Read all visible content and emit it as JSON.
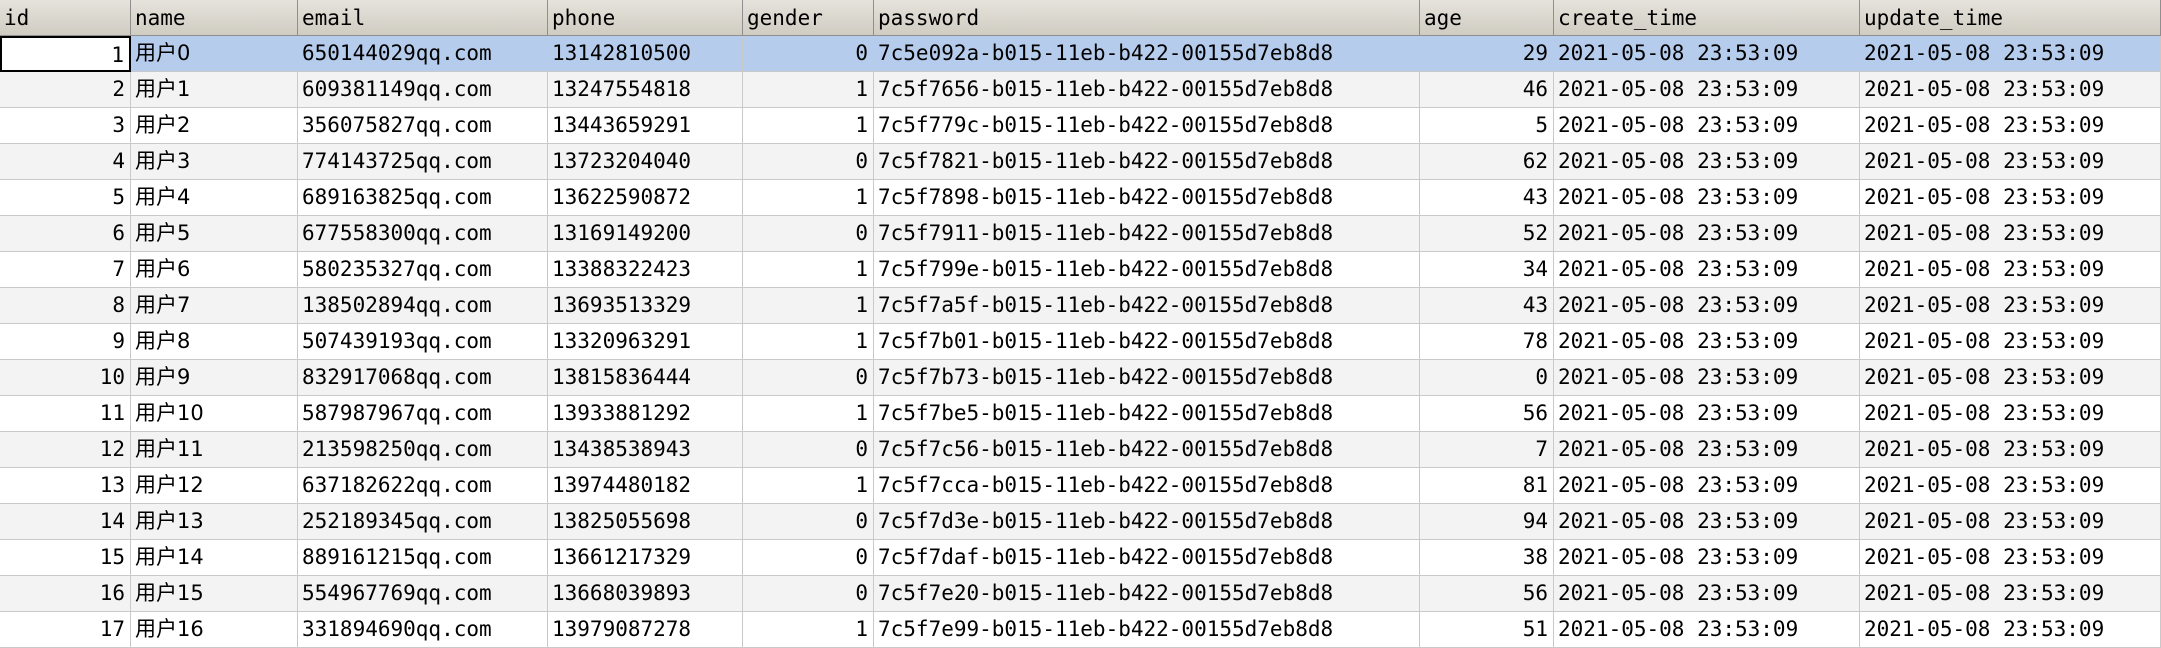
{
  "columns": {
    "id": "id",
    "name": "name",
    "email": "email",
    "phone": "phone",
    "gender": "gender",
    "password": "password",
    "age": "age",
    "create_time": "create_time",
    "update_time": "update_time"
  },
  "selected_row": 1,
  "rows": [
    {
      "id": "1",
      "name": "用户0",
      "email": "650144029qq.com",
      "phone": "13142810500",
      "gender": "0",
      "password": "7c5e092a-b015-11eb-b422-00155d7eb8d8",
      "age": "29",
      "create_time": "2021-05-08 23:53:09",
      "update_time": "2021-05-08 23:53:09"
    },
    {
      "id": "2",
      "name": "用户1",
      "email": "609381149qq.com",
      "phone": "13247554818",
      "gender": "1",
      "password": "7c5f7656-b015-11eb-b422-00155d7eb8d8",
      "age": "46",
      "create_time": "2021-05-08 23:53:09",
      "update_time": "2021-05-08 23:53:09"
    },
    {
      "id": "3",
      "name": "用户2",
      "email": "356075827qq.com",
      "phone": "13443659291",
      "gender": "1",
      "password": "7c5f779c-b015-11eb-b422-00155d7eb8d8",
      "age": "5",
      "create_time": "2021-05-08 23:53:09",
      "update_time": "2021-05-08 23:53:09"
    },
    {
      "id": "4",
      "name": "用户3",
      "email": "774143725qq.com",
      "phone": "13723204040",
      "gender": "0",
      "password": "7c5f7821-b015-11eb-b422-00155d7eb8d8",
      "age": "62",
      "create_time": "2021-05-08 23:53:09",
      "update_time": "2021-05-08 23:53:09"
    },
    {
      "id": "5",
      "name": "用户4",
      "email": "689163825qq.com",
      "phone": "13622590872",
      "gender": "1",
      "password": "7c5f7898-b015-11eb-b422-00155d7eb8d8",
      "age": "43",
      "create_time": "2021-05-08 23:53:09",
      "update_time": "2021-05-08 23:53:09"
    },
    {
      "id": "6",
      "name": "用户5",
      "email": "677558300qq.com",
      "phone": "13169149200",
      "gender": "0",
      "password": "7c5f7911-b015-11eb-b422-00155d7eb8d8",
      "age": "52",
      "create_time": "2021-05-08 23:53:09",
      "update_time": "2021-05-08 23:53:09"
    },
    {
      "id": "7",
      "name": "用户6",
      "email": "580235327qq.com",
      "phone": "13388322423",
      "gender": "1",
      "password": "7c5f799e-b015-11eb-b422-00155d7eb8d8",
      "age": "34",
      "create_time": "2021-05-08 23:53:09",
      "update_time": "2021-05-08 23:53:09"
    },
    {
      "id": "8",
      "name": "用户7",
      "email": "138502894qq.com",
      "phone": "13693513329",
      "gender": "1",
      "password": "7c5f7a5f-b015-11eb-b422-00155d7eb8d8",
      "age": "43",
      "create_time": "2021-05-08 23:53:09",
      "update_time": "2021-05-08 23:53:09"
    },
    {
      "id": "9",
      "name": "用户8",
      "email": "507439193qq.com",
      "phone": "13320963291",
      "gender": "1",
      "password": "7c5f7b01-b015-11eb-b422-00155d7eb8d8",
      "age": "78",
      "create_time": "2021-05-08 23:53:09",
      "update_time": "2021-05-08 23:53:09"
    },
    {
      "id": "10",
      "name": "用户9",
      "email": "832917068qq.com",
      "phone": "13815836444",
      "gender": "0",
      "password": "7c5f7b73-b015-11eb-b422-00155d7eb8d8",
      "age": "0",
      "create_time": "2021-05-08 23:53:09",
      "update_time": "2021-05-08 23:53:09"
    },
    {
      "id": "11",
      "name": "用户10",
      "email": "587987967qq.com",
      "phone": "13933881292",
      "gender": "1",
      "password": "7c5f7be5-b015-11eb-b422-00155d7eb8d8",
      "age": "56",
      "create_time": "2021-05-08 23:53:09",
      "update_time": "2021-05-08 23:53:09"
    },
    {
      "id": "12",
      "name": "用户11",
      "email": "213598250qq.com",
      "phone": "13438538943",
      "gender": "0",
      "password": "7c5f7c56-b015-11eb-b422-00155d7eb8d8",
      "age": "7",
      "create_time": "2021-05-08 23:53:09",
      "update_time": "2021-05-08 23:53:09"
    },
    {
      "id": "13",
      "name": "用户12",
      "email": "637182622qq.com",
      "phone": "13974480182",
      "gender": "1",
      "password": "7c5f7cca-b015-11eb-b422-00155d7eb8d8",
      "age": "81",
      "create_time": "2021-05-08 23:53:09",
      "update_time": "2021-05-08 23:53:09"
    },
    {
      "id": "14",
      "name": "用户13",
      "email": "252189345qq.com",
      "phone": "13825055698",
      "gender": "0",
      "password": "7c5f7d3e-b015-11eb-b422-00155d7eb8d8",
      "age": "94",
      "create_time": "2021-05-08 23:53:09",
      "update_time": "2021-05-08 23:53:09"
    },
    {
      "id": "15",
      "name": "用户14",
      "email": "889161215qq.com",
      "phone": "13661217329",
      "gender": "0",
      "password": "7c5f7daf-b015-11eb-b422-00155d7eb8d8",
      "age": "38",
      "create_time": "2021-05-08 23:53:09",
      "update_time": "2021-05-08 23:53:09"
    },
    {
      "id": "16",
      "name": "用户15",
      "email": "554967769qq.com",
      "phone": "13668039893",
      "gender": "0",
      "password": "7c5f7e20-b015-11eb-b422-00155d7eb8d8",
      "age": "56",
      "create_time": "2021-05-08 23:53:09",
      "update_time": "2021-05-08 23:53:09"
    },
    {
      "id": "17",
      "name": "用户16",
      "email": "331894690qq.com",
      "phone": "13979087278",
      "gender": "1",
      "password": "7c5f7e99-b015-11eb-b422-00155d7eb8d8",
      "age": "51",
      "create_time": "2021-05-08 23:53:09",
      "update_time": "2021-05-08 23:53:09"
    }
  ]
}
